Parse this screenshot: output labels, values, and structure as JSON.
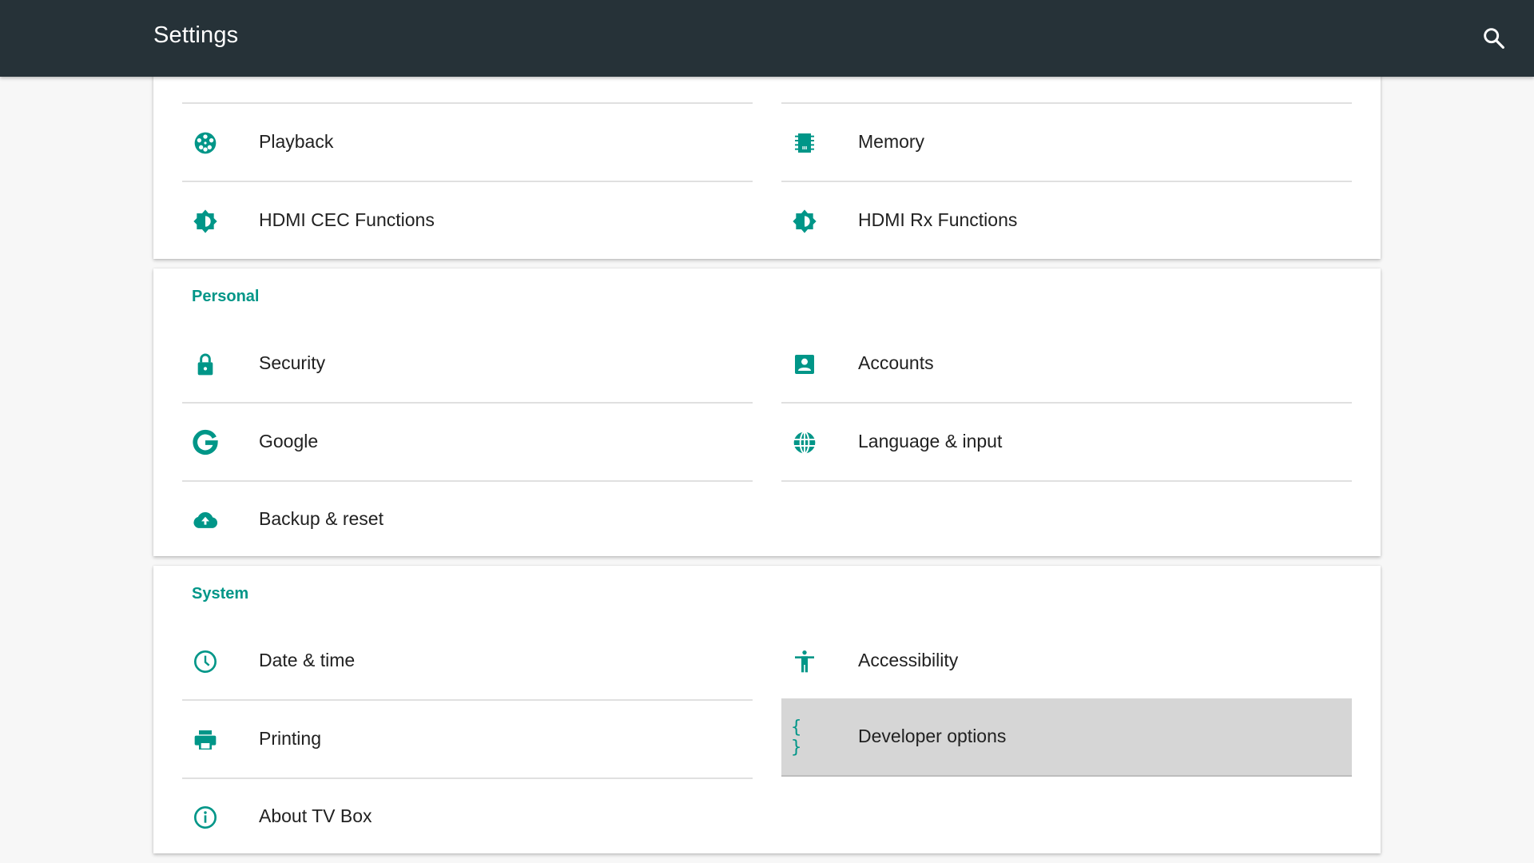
{
  "appbar": {
    "title": "Settings",
    "search_icon": "search-icon"
  },
  "accent_color": "#009688",
  "sections": {
    "device": {
      "label": "",
      "items": [
        {
          "label": "Playback",
          "icon": "film-reel-icon"
        },
        {
          "label": "Memory",
          "icon": "memory-chip-icon"
        },
        {
          "label": "HDMI CEC Functions",
          "icon": "brightness-icon"
        },
        {
          "label": "HDMI Rx Functions",
          "icon": "brightness-icon"
        }
      ]
    },
    "personal": {
      "label": "Personal",
      "items": [
        {
          "label": "Security",
          "icon": "lock-icon"
        },
        {
          "label": "Accounts",
          "icon": "account-box-icon"
        },
        {
          "label": "Google",
          "icon": "google-icon"
        },
        {
          "label": "Language & input",
          "icon": "globe-icon"
        },
        {
          "label": "Backup & reset",
          "icon": "cloud-upload-icon"
        }
      ]
    },
    "system": {
      "label": "System",
      "items": [
        {
          "label": "Date & time",
          "icon": "clock-icon"
        },
        {
          "label": "Accessibility",
          "icon": "accessibility-icon"
        },
        {
          "label": "Printing",
          "icon": "printer-icon"
        },
        {
          "label": "Developer options",
          "icon": "code-braces-icon",
          "selected": true
        },
        {
          "label": "About TV Box",
          "icon": "info-icon"
        }
      ],
      "braces_glyph": "{ }"
    }
  }
}
